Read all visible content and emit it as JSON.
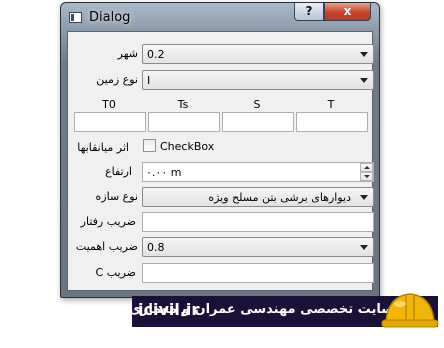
{
  "window": {
    "title": "Dialog",
    "help_label": "?",
    "close_label": "x"
  },
  "form": {
    "city": {
      "label": "شهر",
      "value": "0.2"
    },
    "soil_type": {
      "label": "نوع زمین",
      "value": "I"
    },
    "table_headers": [
      "T0",
      "Ts",
      "S",
      "T"
    ],
    "infill_effect": {
      "label": "اثر میانقابها",
      "checkbox_label": "CheckBox",
      "checked": false
    },
    "height": {
      "label": "ارتفاع",
      "value": "۰.۰۰ m"
    },
    "structure_type": {
      "label": "نوع سازه",
      "value": "دیوارهای برشی بتن مسلح ویژه"
    },
    "behavior_factor": {
      "label": "ضریب رفتار",
      "value": ""
    },
    "importance_factor": {
      "label": "ضریب اهمیت",
      "value": "0.8"
    },
    "coefficient_c": {
      "label": "ضریب C",
      "value": ""
    }
  },
  "banner": {
    "site": "icivil.ir",
    "text": "سایت تخصصی مهندسی عمران و معماری"
  },
  "colors": {
    "banner_bg": "#1a1038",
    "close_button": "#c9442a",
    "helmet": "#f2b705"
  }
}
